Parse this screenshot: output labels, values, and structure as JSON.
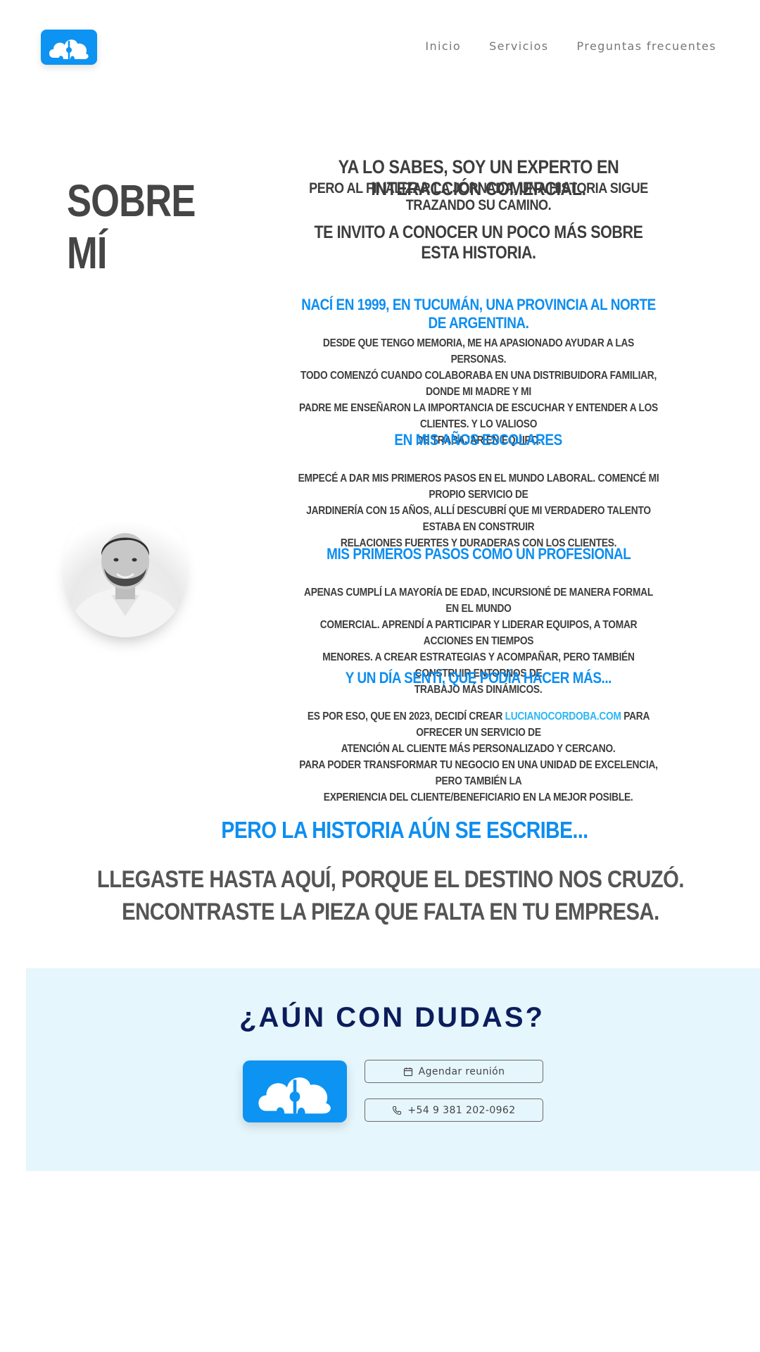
{
  "brand": {
    "color": "#0d93f2",
    "icon": "cloud-puzzle-logo"
  },
  "nav": {
    "items": [
      {
        "label": "Inicio"
      },
      {
        "label": "Servicios"
      },
      {
        "label": "Preguntas frecuentes"
      }
    ]
  },
  "page": {
    "title": "SOBRE MÍ"
  },
  "intro": {
    "line1": "YA LO SABES, SOY UN EXPERTO EN INTERACCIÓN COMERCIAL.",
    "line2": "PERO AL FINALIZAR LA JORNADA, UNA HISTORIA SIGUE TRAZANDO SU CAMINO.",
    "line3": "TE INVITO A CONOCER UN POCO MÁS SOBRE ESTA HISTORIA."
  },
  "sections": [
    {
      "heading": "NACÍ EN 1999, EN TUCUMÁN, UNA PROVINCIA AL NORTE DE ARGENTINA.",
      "lines": [
        "DESDE QUE TENGO MEMORIA, ME HA APASIONADO AYUDAR A LAS PERSONAS.",
        "TODO COMENZÓ CUANDO COLABORABA EN UNA DISTRIBUIDORA FAMILIAR, DONDE MI MADRE Y MI",
        "PADRE ME ENSEÑARON LA IMPORTANCIA DE ESCUCHAR Y ENTENDER A LOS CLIENTES. Y LO VALIOSO",
        "DE TRABAJAR EN EQUIPO."
      ]
    },
    {
      "heading": "EN MIS AÑOS ESCOLARES",
      "lines": [
        "EMPECÉ A DAR MIS PRIMEROS PASOS EN EL MUNDO LABORAL. COMENCÉ MI PROPIO SERVICIO DE",
        "JARDINERÍA CON 15 AÑOS, ALLÍ DESCUBRÍ QUE MI VERDADERO TALENTO ESTABA EN CONSTRUIR",
        "RELACIONES FUERTES Y DURADERAS CON LOS CLIENTES."
      ]
    },
    {
      "heading": "MIS PRIMEROS PASOS COMO UN PROFESIONAL",
      "lines": [
        "APENAS CUMPLÍ LA MAYORÍA DE EDAD, INCURSIONÉ DE MANERA FORMAL EN EL MUNDO",
        "COMERCIAL. APRENDÍ A PARTICIPAR Y LIDERAR EQUIPOS, A TOMAR ACCIONES EN TIEMPOS",
        "MENORES. A CREAR ESTRATEGIAS Y ACOMPAÑAR, PERO TAMBIÉN CONSTRUIR ENTORNOS DE",
        "TRABAJO MÁS DINÁMICOS."
      ]
    },
    {
      "heading": "Y UN DÍA SENTÍ, QUE PODÍA HACER MÁS...",
      "line1_pre": "ES POR ESO, QUE EN 2023, DECIDÍ CREAR ",
      "link": "LUCIANOCORDOBA.COM",
      "line1_post": " PARA OFRECER UN SERVICIO DE",
      "lines": [
        "ATENCIÓN AL CLIENTE MÁS PERSONALIZADO Y CERCANO.",
        "PARA PODER TRANSFORMAR TU NEGOCIO EN UNA UNIDAD DE EXCELENCIA, PERO TAMBIÉN LA",
        "EXPERIENCIA DEL CLIENTE/BENEFICIARIO EN LA MEJOR POSIBLE."
      ]
    }
  ],
  "story": {
    "heading": "PERO LA HISTORIA AÚN SE ESCRIBE...",
    "line1": "LLEGASTE HASTA AQUÍ, PORQUE EL DESTINO NOS CRUZÓ.",
    "line2": "ENCONTRASTE LA PIEZA QUE FALTA EN TU EMPRESA."
  },
  "cta": {
    "title": "¿AÚN CON DUDAS?",
    "schedule_label": "Agendar reunión",
    "schedule_icon": "calendar-icon",
    "phone_label": "+54 9 381 202-0962",
    "phone_icon": "phone-icon",
    "background": "#e6f6fd"
  }
}
